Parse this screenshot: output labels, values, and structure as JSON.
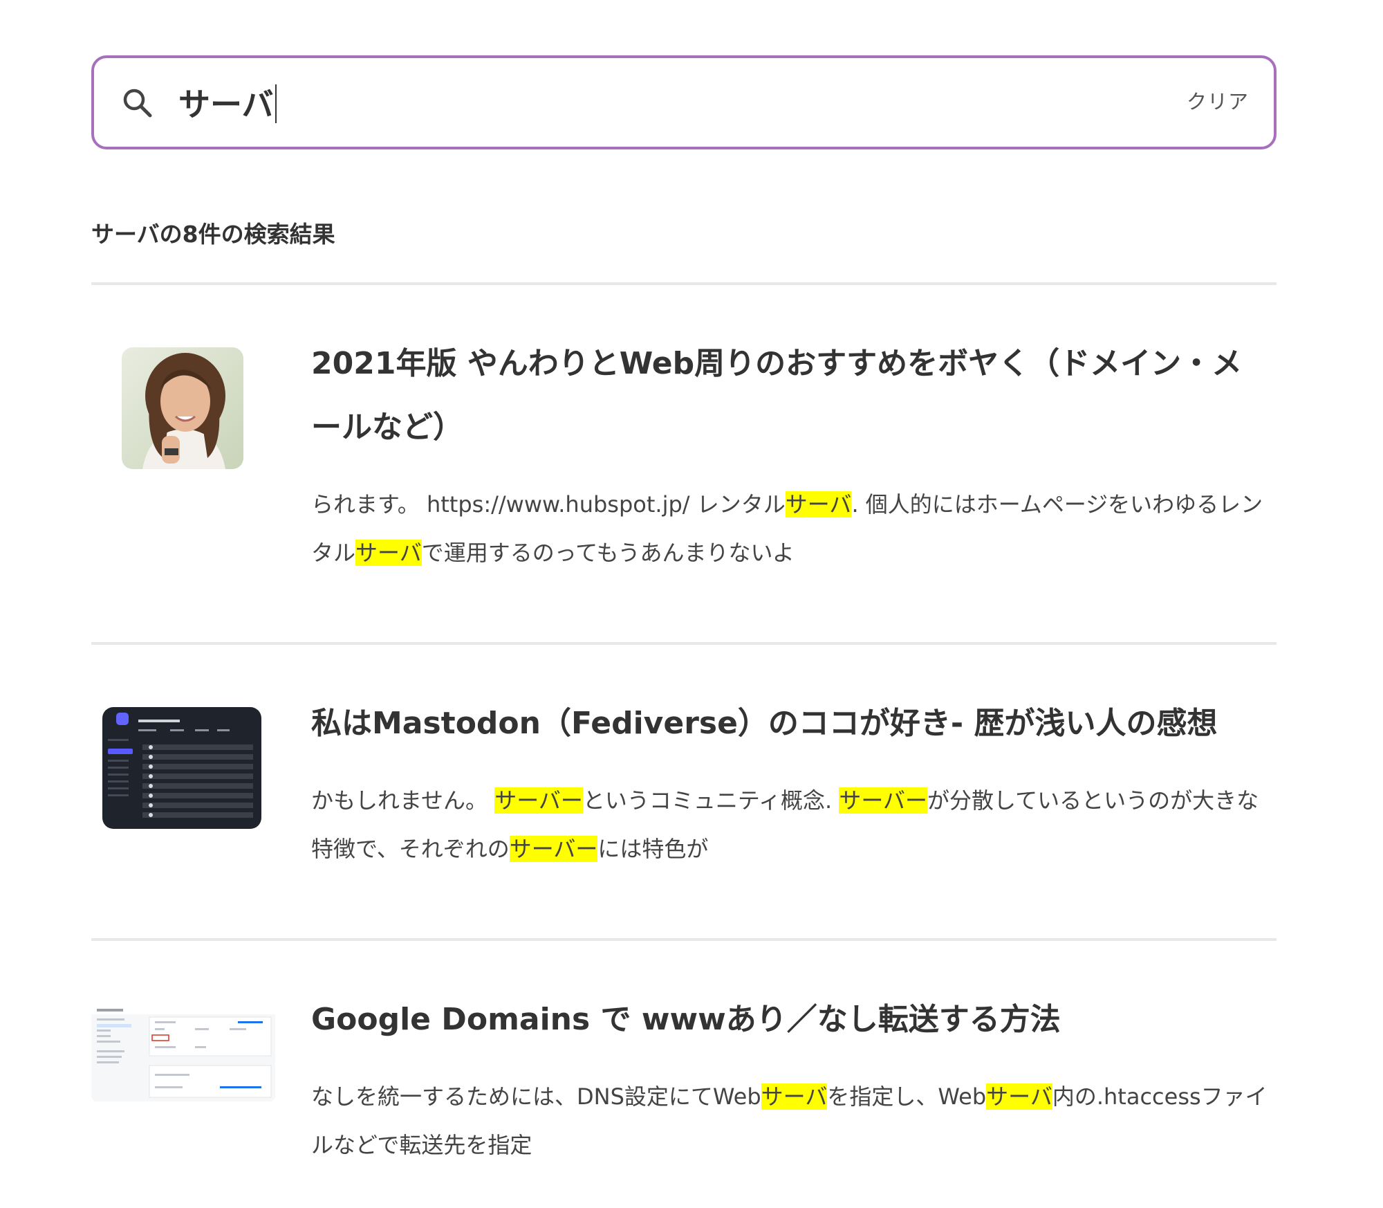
{
  "search": {
    "value": "サーバ",
    "clear_label": "クリア"
  },
  "results_heading": "サーバの8件の検索結果",
  "highlight_color": "#ffff00",
  "accent_color": "#a86fbd",
  "results": [
    {
      "title": "2021年版 やんわりとWeb周りのおすすめをボヤく（ドメイン・メールなど）",
      "thumbnail": "portrait-photo",
      "snippet": [
        {
          "text": "られます。 https://www.hubspot.jp/ レンタル"
        },
        {
          "text": "サーバ",
          "hl": true
        },
        {
          "text": ". 個人的にはホームページをいわゆるレンタル"
        },
        {
          "text": "サーバ",
          "hl": true
        },
        {
          "text": "で運用するのってもうあんまりないよ"
        }
      ]
    },
    {
      "title": "私はMastodon（Fediverse）のココが好き- 歴が浅い人の感想",
      "thumbnail": "mastodon-screenshot",
      "snippet": [
        {
          "text": "かもしれません。 "
        },
        {
          "text": "サーバー",
          "hl": true
        },
        {
          "text": "というコミュニティ概念. "
        },
        {
          "text": "サーバー",
          "hl": true
        },
        {
          "text": "が分散しているというのが大きな特徴で、それぞれの"
        },
        {
          "text": "サーバー",
          "hl": true
        },
        {
          "text": "には特色が"
        }
      ]
    },
    {
      "title": "Google Domains で wwwあり／なし転送する方法",
      "thumbnail": "google-domains-screenshot",
      "snippet": [
        {
          "text": "なしを統一するためには、DNS設定にてWeb"
        },
        {
          "text": "サーバ",
          "hl": true
        },
        {
          "text": "を指定し、Web"
        },
        {
          "text": "サーバ",
          "hl": true
        },
        {
          "text": "内の.htaccessファイルなどで転送先を指定"
        }
      ]
    }
  ]
}
